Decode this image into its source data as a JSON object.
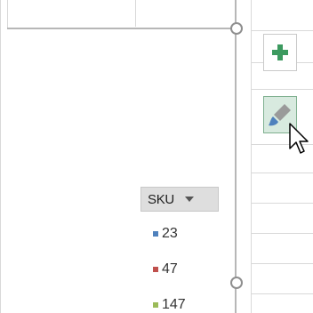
{
  "chart": {
    "field_button": {
      "label": "SKU"
    },
    "legend": [
      {
        "label": "23",
        "color": "#4f81bd"
      },
      {
        "label": "47",
        "color": "#c0504d"
      },
      {
        "label": "147",
        "color": "#9bbb59"
      }
    ]
  },
  "side_buttons": [
    {
      "name": "add-chart-element",
      "icon": "plus-icon",
      "color": "#3c9a5f"
    },
    {
      "name": "chart-styles",
      "icon": "paintbrush-icon",
      "color": "#4f81bd",
      "state": "hovered"
    }
  ],
  "cursor": {
    "icon": "pointer-cursor-icon"
  }
}
